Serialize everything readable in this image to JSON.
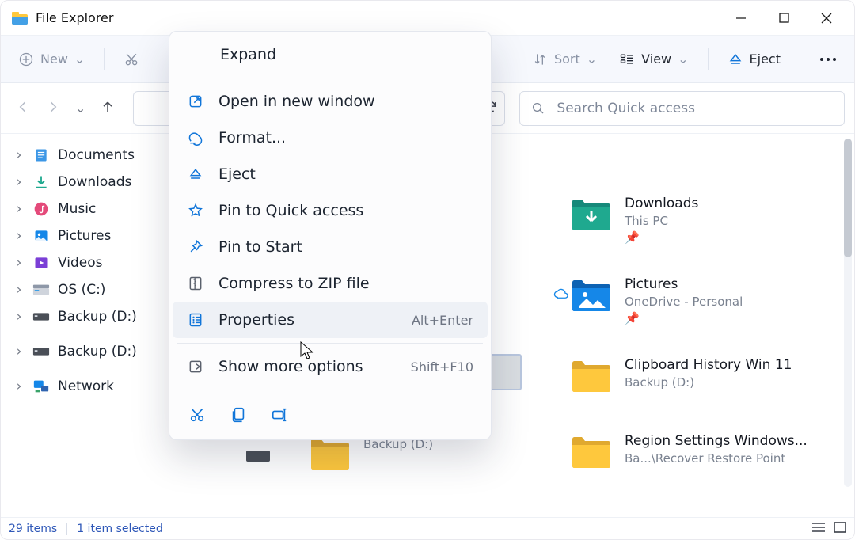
{
  "window": {
    "title": "File Explorer"
  },
  "toolbar": {
    "new": "New",
    "sort": "Sort",
    "view": "View",
    "eject": "Eject"
  },
  "search": {
    "placeholder": "Search Quick access"
  },
  "sidebar": {
    "items": [
      {
        "label": "Documents"
      },
      {
        "label": "Downloads"
      },
      {
        "label": "Music"
      },
      {
        "label": "Pictures"
      },
      {
        "label": "Videos"
      },
      {
        "label": "OS (C:)"
      },
      {
        "label": "Backup (D:)"
      },
      {
        "label": "Backup (D:)"
      },
      {
        "label": "Network"
      }
    ]
  },
  "content": {
    "items": [
      {
        "name": "Downloads",
        "sub": "This PC",
        "pinned": true,
        "color": "teal"
      },
      {
        "name": "Pictures",
        "sub": "OneDrive - Personal",
        "pinned": true,
        "color": "blue",
        "cloud": true
      },
      {
        "name": "Clipboard History Win 11",
        "sub": "Backup (D:)",
        "color": "y"
      },
      {
        "name": "Region Settings Windows...",
        "sub": "Ba...\\Recover Restore Point",
        "color": "y"
      }
    ],
    "target": {
      "name": "",
      "sub": "Backup (D:)",
      "color": "y",
      "selected": true
    }
  },
  "context_menu": {
    "header": "Expand",
    "items": [
      {
        "label": "Open in new window",
        "icon": "open-new-window"
      },
      {
        "label": "Format...",
        "icon": "format"
      },
      {
        "label": "Eject",
        "icon": "eject"
      },
      {
        "label": "Pin to Quick access",
        "icon": "star"
      },
      {
        "label": "Pin to Start",
        "icon": "pin"
      },
      {
        "label": "Compress to ZIP file",
        "icon": "zip"
      },
      {
        "label": "Properties",
        "icon": "properties",
        "shortcut": "Alt+Enter",
        "hover": true
      },
      {
        "label": "Show more options",
        "icon": "more-box",
        "shortcut": "Shift+F10"
      }
    ]
  },
  "status": {
    "count": "29 items",
    "selection": "1 item selected"
  }
}
